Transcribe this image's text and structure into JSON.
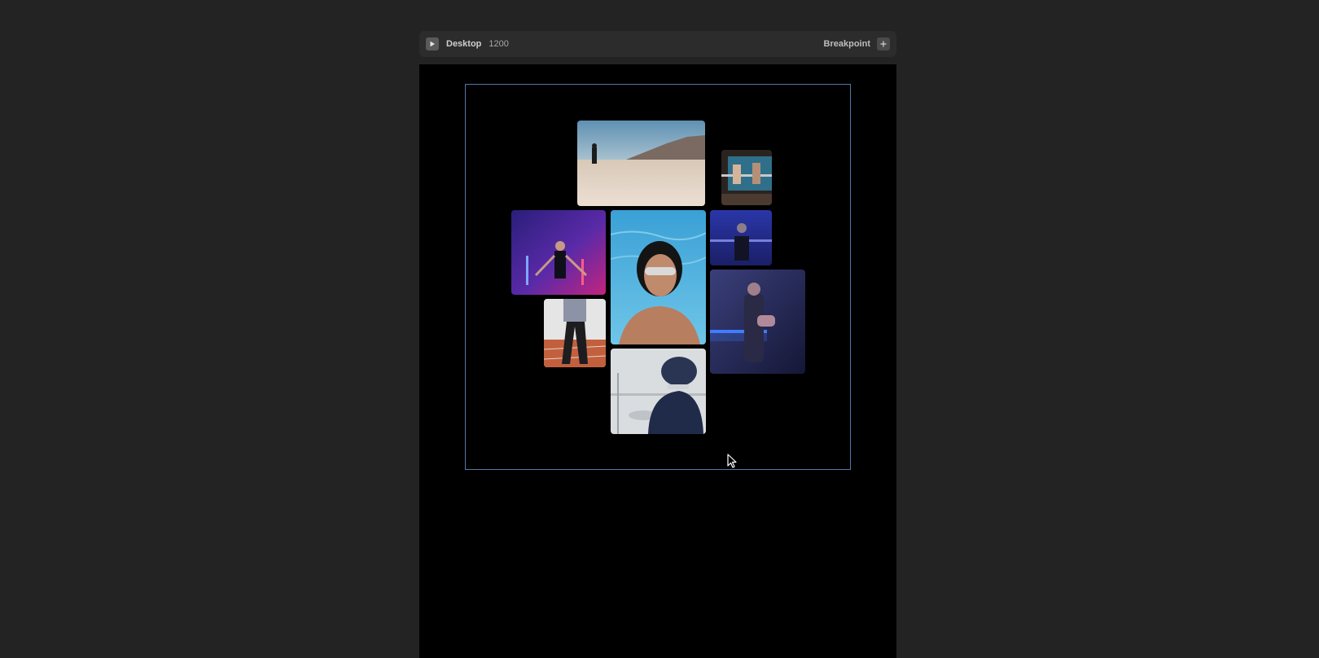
{
  "toolbar": {
    "device_label": "Desktop",
    "width_label": "1200",
    "breakpoint_label": "Breakpoint",
    "play_icon": "play-icon",
    "add_icon": "plus-icon"
  },
  "gallery": {
    "tiles": [
      {
        "name": "photo-desert-rider"
      },
      {
        "name": "photo-boxers-ring"
      },
      {
        "name": "photo-jump-rope-neon"
      },
      {
        "name": "photo-woman-sunglasses-pool"
      },
      {
        "name": "photo-pullup-blue"
      },
      {
        "name": "photo-runner-track"
      },
      {
        "name": "photo-boxer-blue-light"
      },
      {
        "name": "photo-tennis-player-cap"
      }
    ]
  },
  "colors": {
    "background": "#232323",
    "toolbar": "#2c2c2c",
    "canvas": "#000000",
    "selection": "#5577aa"
  }
}
